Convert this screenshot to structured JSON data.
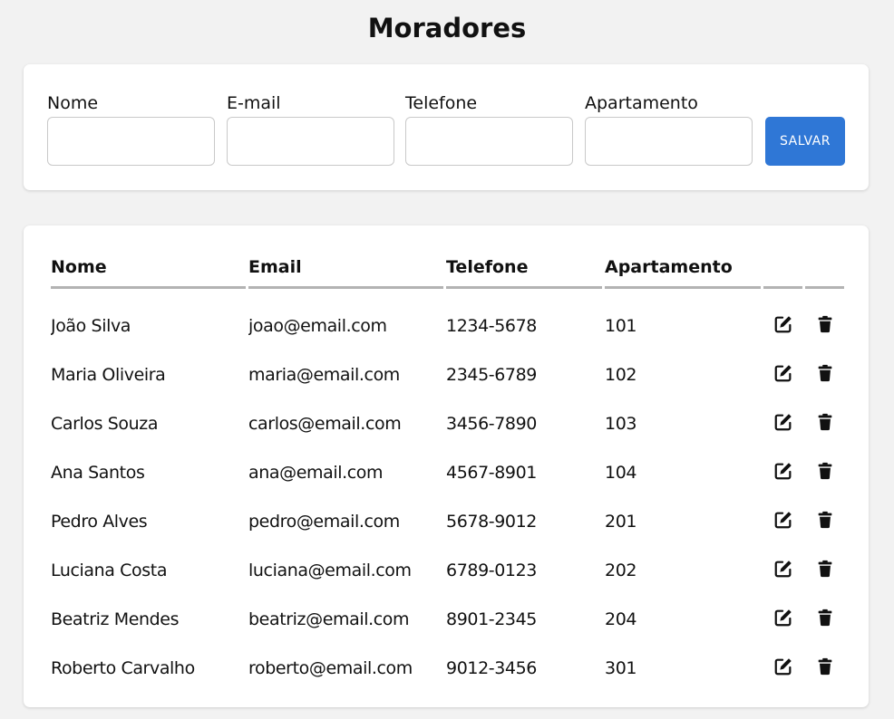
{
  "page": {
    "title": "Moradores"
  },
  "form": {
    "fields": [
      {
        "label": "Nome",
        "value": ""
      },
      {
        "label": "E-mail",
        "value": ""
      },
      {
        "label": "Telefone",
        "value": ""
      },
      {
        "label": "Apartamento",
        "value": ""
      }
    ],
    "save_label": "SALVAR"
  },
  "table": {
    "headers": [
      "Nome",
      "Email",
      "Telefone",
      "Apartamento"
    ],
    "rows": [
      {
        "nome": "João Silva",
        "email": "joao@email.com",
        "telefone": "1234-5678",
        "apartamento": "101"
      },
      {
        "nome": "Maria Oliveira",
        "email": "maria@email.com",
        "telefone": "2345-6789",
        "apartamento": "102"
      },
      {
        "nome": "Carlos Souza",
        "email": "carlos@email.com",
        "telefone": "3456-7890",
        "apartamento": "103"
      },
      {
        "nome": "Ana Santos",
        "email": "ana@email.com",
        "telefone": "4567-8901",
        "apartamento": "104"
      },
      {
        "nome": "Pedro Alves",
        "email": "pedro@email.com",
        "telefone": "5678-9012",
        "apartamento": "201"
      },
      {
        "nome": "Luciana Costa",
        "email": "luciana@email.com",
        "telefone": "6789-0123",
        "apartamento": "202"
      },
      {
        "nome": "Beatriz Mendes",
        "email": "beatriz@email.com",
        "telefone": "8901-2345",
        "apartamento": "204"
      },
      {
        "nome": "Roberto Carvalho",
        "email": "roberto@email.com",
        "telefone": "9012-3456",
        "apartamento": "301"
      }
    ],
    "row_actions": [
      "edit-icon",
      "trash-icon"
    ]
  },
  "colors": {
    "background": "#f2f2f2",
    "card": "#ffffff",
    "primary_button": "#2f77d6",
    "header_rule": "#b3b3b3"
  }
}
